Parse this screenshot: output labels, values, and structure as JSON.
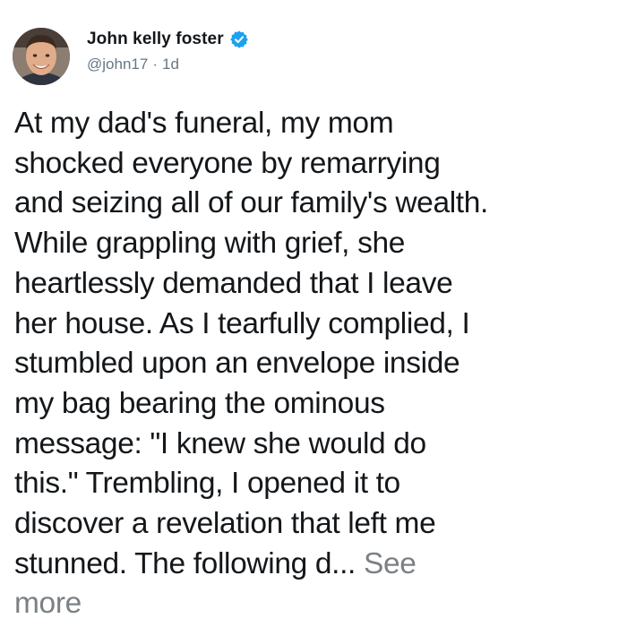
{
  "tweet": {
    "author_name": "John kelly foster",
    "handle": "@john17",
    "separator": "·",
    "timestamp": "1d",
    "text_lines": [
      "At my dad's funeral, my mom",
      "shocked everyone by remarrying",
      "and seizing all of our family's wealth.",
      "While grappling with grief, she",
      "heartlessly demanded that I leave",
      "her house. As I tearfully complied, I",
      "stumbled upon an envelope inside",
      "my bag bearing the ominous",
      "message: \"I knew she would do",
      "this.\" Trembling, I opened it to",
      "discover a revelation that left me",
      "stunned. The following d... "
    ],
    "see_more_line1": "See",
    "see_more_line2": "more",
    "icons": {
      "avatar": "avatar",
      "verified": "verified-badge-icon"
    },
    "colors": {
      "text": "#14171a",
      "muted": "#657786",
      "see_more": "#7a8186",
      "verified": "#1da1f2"
    }
  }
}
